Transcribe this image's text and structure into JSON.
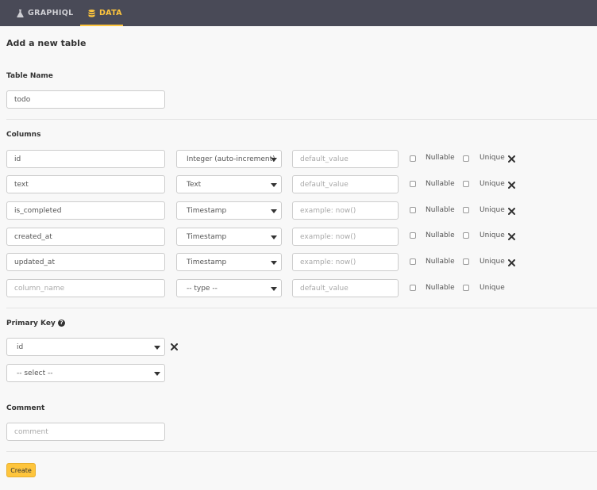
{
  "nav": {
    "tabs": [
      {
        "label": "GRAPHIQL",
        "icon": "flask-icon"
      },
      {
        "label": "DATA",
        "icon": "database-icon",
        "active": true
      }
    ],
    "accent": "#fec53d",
    "background": "#494a57"
  },
  "page": {
    "title": "Add a new table"
  },
  "table_name": {
    "label": "Table Name",
    "value": "todo"
  },
  "columns": {
    "label": "Columns",
    "rows": [
      {
        "name": "id",
        "type": "Integer (auto-increment)",
        "default_placeholder": "default_value",
        "nullable": "Nullable",
        "unique": "Unique"
      },
      {
        "name": "text",
        "type": "Text",
        "default_placeholder": "default_value",
        "nullable": "Nullable",
        "unique": "Unique"
      },
      {
        "name": "is_completed",
        "type": "Timestamp",
        "default_placeholder": "example: now()",
        "nullable": "Nullable",
        "unique": "Unique"
      },
      {
        "name": "created_at",
        "type": "Timestamp",
        "default_placeholder": "example: now()",
        "nullable": "Nullable",
        "unique": "Unique"
      },
      {
        "name": "updated_at",
        "type": "Timestamp",
        "default_placeholder": "example: now()",
        "nullable": "Nullable",
        "unique": "Unique"
      }
    ],
    "new_row": {
      "name_placeholder": "column_name",
      "type": "-- type --",
      "default_placeholder": "default_value",
      "nullable": "Nullable",
      "unique": "Unique"
    }
  },
  "primary_key": {
    "label": "Primary Key",
    "selected": "id",
    "new_select": "-- select --"
  },
  "comment": {
    "label": "Comment",
    "placeholder": "comment"
  },
  "actions": {
    "create_label": "Create"
  }
}
